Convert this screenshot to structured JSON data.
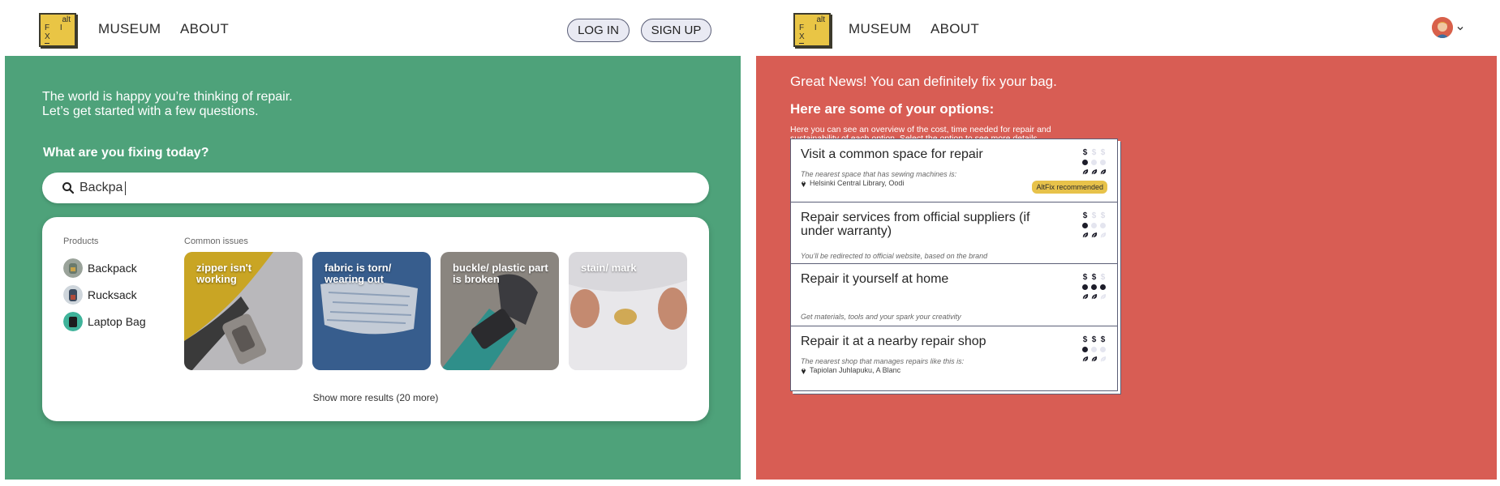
{
  "left": {
    "nav": {
      "logo_alt": "alt",
      "logo_fix": "F I X",
      "museum": "MUSEUM",
      "about": "ABOUT",
      "login": "LOG IN",
      "signup": "SIGN UP"
    },
    "intro_line1": "The world is happy you’re thinking of repair.",
    "intro_line2": "Let’s get started with a few questions.",
    "question": "What are you fixing today?",
    "search_value": "Backpa",
    "search_icon": "search-icon",
    "results": {
      "products_header": "Products",
      "issues_header": "Common issues",
      "products": [
        {
          "label": "Backpack"
        },
        {
          "label": "Rucksack"
        },
        {
          "label": "Laptop Bag"
        }
      ],
      "issues": [
        {
          "label": "zipper isn't working"
        },
        {
          "label": "fabric is torn/ wearing out"
        },
        {
          "label": "buckle/ plastic part is broken"
        },
        {
          "label": "stain/ mark"
        }
      ],
      "more": "Show more results (20 more)"
    }
  },
  "right": {
    "nav": {
      "logo_alt": "alt",
      "logo_fix": "F I X",
      "museum": "MUSEUM",
      "about": "ABOUT"
    },
    "news": "Great News! You can definitely fix your bag.",
    "options_title": "Here are some of your options:",
    "description": "Here you can see an overview of the cost, time needed for repair and sustainability of each option. Select the option to see more details.",
    "options": [
      {
        "title": "Visit a common space for repair",
        "subtitle": "The nearest space that has sewing machines is:",
        "location": "Helsinki Central Library, Oodi",
        "badge": "AltFix recommended",
        "cost": 1,
        "time": 1,
        "sustainability": 3
      },
      {
        "title": "Repair services from official suppliers (if under warranty)",
        "subtitle": "You’ll be redirected to official website, based on the brand",
        "location": "",
        "cost": 1,
        "time": 1,
        "sustainability": 2
      },
      {
        "title": "Repair it yourself at home",
        "subtitle": "Get materials, tools and your spark your creativity",
        "location": "",
        "cost": 2,
        "time": 3,
        "sustainability": 2
      },
      {
        "title": "Repair it at a nearby repair shop",
        "subtitle": "The nearest shop that manages repairs like this is:",
        "location": "Tapiolan Juhlapuku, A Blanc",
        "cost": 3,
        "time": 1,
        "sustainability": 2
      }
    ],
    "dollar_glyph": "$"
  },
  "colors": {
    "green_panel": "#4ea27a",
    "red_panel": "#d85d54",
    "logo_yellow": "#e9c545",
    "badge_yellow": "#e7c24a"
  }
}
